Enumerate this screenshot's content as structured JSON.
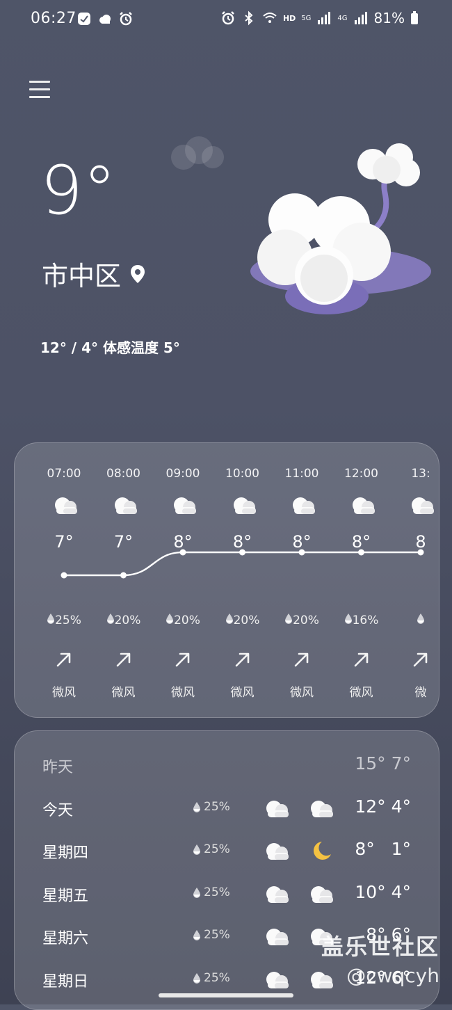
{
  "status_bar": {
    "time": "06:27",
    "net_hd": "HD",
    "net_5g": "5G",
    "net_4g": "4G",
    "battery": "81%"
  },
  "current": {
    "temperature": "9°",
    "location": "市中区",
    "range_feels": "12° / 4° 体感温度 5°"
  },
  "hourly": [
    {
      "time": "07:00",
      "temp": "7°",
      "value": 7,
      "precip": "25%",
      "wind": "微风"
    },
    {
      "time": "08:00",
      "temp": "7°",
      "value": 7,
      "precip": "20%",
      "wind": "微风"
    },
    {
      "time": "09:00",
      "temp": "8°",
      "value": 8,
      "precip": "20%",
      "wind": "微风"
    },
    {
      "time": "10:00",
      "temp": "8°",
      "value": 8,
      "precip": "20%",
      "wind": "微风"
    },
    {
      "time": "11:00",
      "temp": "8°",
      "value": 8,
      "precip": "20%",
      "wind": "微风"
    },
    {
      "time": "12:00",
      "temp": "8°",
      "value": 8,
      "precip": "16%",
      "wind": "微风"
    },
    {
      "time": "13:",
      "temp": "8",
      "value": 8,
      "precip": "",
      "wind": "微"
    }
  ],
  "daily": [
    {
      "day": "昨天",
      "precip": "",
      "icon_day": "",
      "icon_night": "",
      "temps": "15° 7°",
      "muted": true
    },
    {
      "day": "今天",
      "precip": "25%",
      "icon_day": "cloud-icon",
      "icon_night": "cloud-icon",
      "temps": "12° 4°"
    },
    {
      "day": "星期四",
      "precip": "25%",
      "icon_day": "cloud-icon",
      "icon_night": "moon-icon",
      "temps": "8°   1°"
    },
    {
      "day": "星期五",
      "precip": "25%",
      "icon_day": "cloud-icon",
      "icon_night": "cloud-icon",
      "temps": "10° 4°"
    },
    {
      "day": "星期六",
      "precip": "25%",
      "icon_day": "cloud-icon",
      "icon_night": "cloud-icon",
      "temps": "8° 6°"
    },
    {
      "day": "星期日",
      "precip": "25%",
      "icon_day": "cloud-icon",
      "icon_night": "cloud-icon",
      "temps": "12° 6°"
    }
  ],
  "watermark": {
    "line1": "盖乐世社区",
    "line2": "@cwqcyh"
  },
  "colors": {
    "accent_moon": "#f5c242",
    "card_bg": "rgba(255,255,255,0.16)"
  }
}
